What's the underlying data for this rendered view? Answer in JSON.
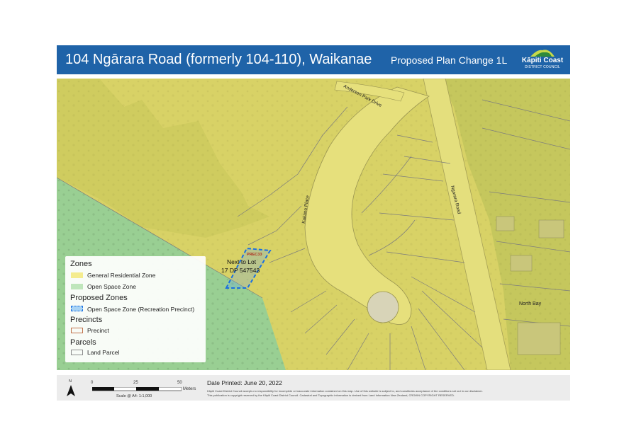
{
  "header": {
    "title": "104 Ngārara Road (formerly 104-110), Waikanae",
    "plan_change": "Proposed Plan Change 1L",
    "logo_name": "Kāpiti Coast",
    "logo_sub": "DISTRICT COUNCIL"
  },
  "map": {
    "road_labels": {
      "anderson": "Anderson Park Drive",
      "kakano": "Kakano Place",
      "ngarara": "Ngarara Road",
      "north_bay": "North Bay"
    },
    "site_label_line1": "Next to Lot",
    "site_label_line2": "17 DP 547543",
    "site_tag": "PREC33",
    "colors": {
      "residential_zone": "#dcd66a",
      "open_space_zone": "#9ed39a",
      "recreation_precinct_outline": "#1a6fe0",
      "precinct_outline": "#c0714a",
      "parcel_outline": "#7d7d7d"
    }
  },
  "legend": {
    "zones_heading": "Zones",
    "general_residential": "General Residential Zone",
    "open_space": "Open Space Zone",
    "proposed_heading": "Proposed Zones",
    "recreation_precinct": "Open Space Zone (Recreation Precinct)",
    "precincts_heading": "Precincts",
    "precinct": "Precinct",
    "parcels_heading": "Parcels",
    "land_parcel": "Land Parcel"
  },
  "footer": {
    "north": "N",
    "scale_0": "0",
    "scale_25": "25",
    "scale_50": "50",
    "scale_unit": "Meters",
    "scale_text": "Scale @ A4: 1:1,000",
    "date_printed": "Date Printed: June 20, 2022",
    "disclaimer_1": "Kāpiti Coast District Council accepts no responsibility for incomplete or inaccurate information contained on this map. Use of this website is subject to, and constitutes acceptance of the conditions set out in our disclaimer.",
    "disclaimer_2": "This publication is copyright reserved by the Kāpiti Coast District Council. Cadastral and Topographic information is derived from Land Information New Zealand, CROWN COPYRIGHT RESERVED."
  }
}
